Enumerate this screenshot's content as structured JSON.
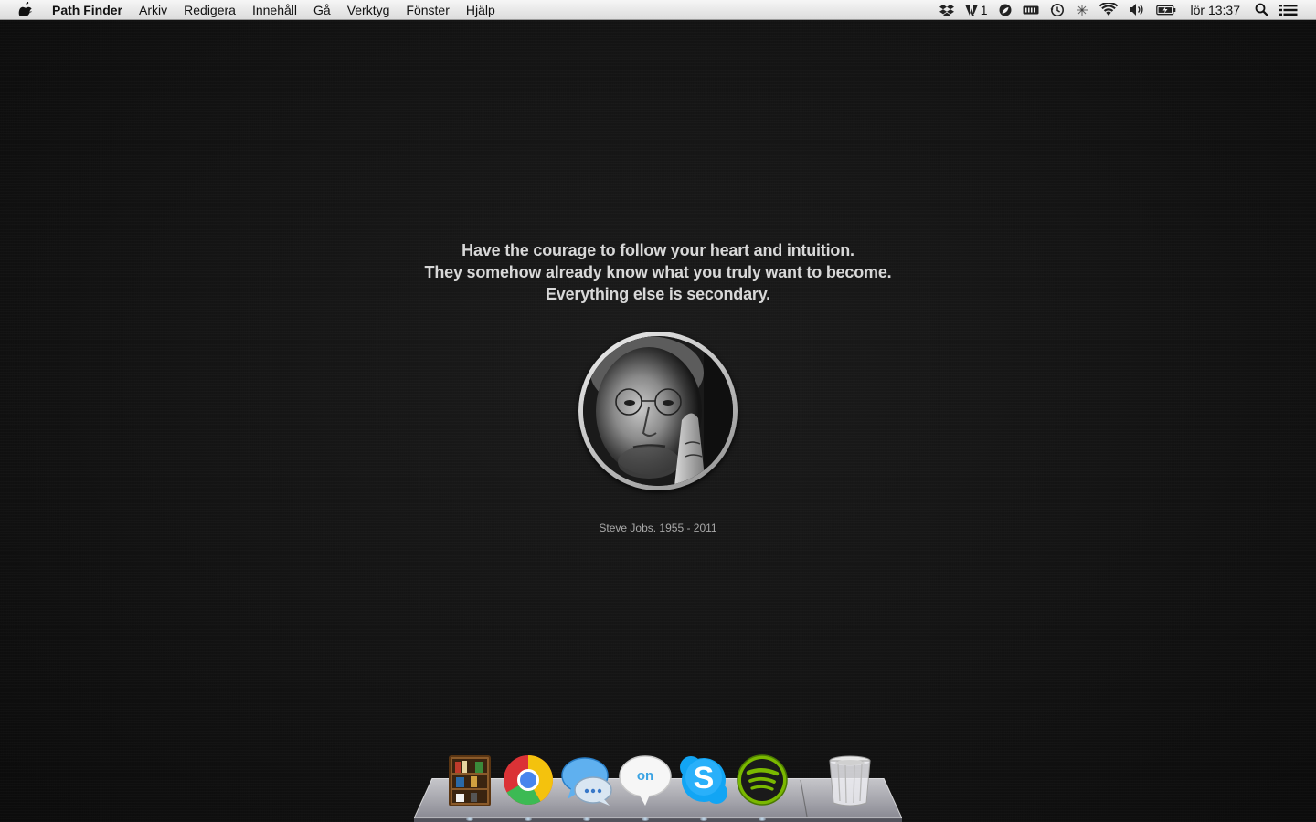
{
  "menubar": {
    "app_name": "Path Finder",
    "menus": [
      "Arkiv",
      "Redigera",
      "Innehåll",
      "Gå",
      "Verktyg",
      "Fönster",
      "Hjälp"
    ],
    "status_icons": [
      "dropbox-icon",
      "adobe-icon",
      "leaf-icon",
      "battery-meter-icon",
      "time-machine-icon",
      "bluetooth-icon",
      "wifi-icon",
      "volume-icon",
      "battery-icon"
    ],
    "adobe_count": "1",
    "clock": "lör 13:37"
  },
  "desktop": {
    "quote_lines": [
      "Have the courage to follow your heart and intuition.",
      "They somehow already know what you truly want to become.",
      "Everything else is secondary."
    ],
    "caption": "Steve Jobs. 1955 - 2011"
  },
  "dock": {
    "apps": [
      "Delicious Library",
      "Google Chrome",
      "iChat",
      "Messenger",
      "Skype",
      "Spotify",
      "Trash"
    ],
    "skype_label": "S",
    "messenger_label": "on"
  },
  "colors": {
    "background": "#141414",
    "menubar": "#e8e8e8",
    "quote_text": "#d8d8d8"
  }
}
